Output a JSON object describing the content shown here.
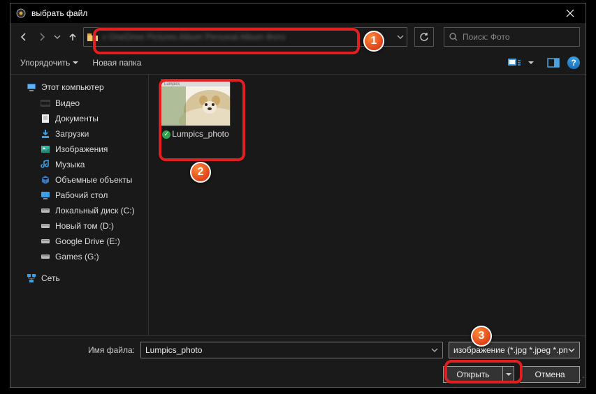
{
  "titlebar": {
    "title": "выбрать файл"
  },
  "nav": {
    "breadcrumb_blurred": "«  OneDrive   Pictures   Album Personal Album   Фото",
    "search_placeholder": "Поиск: Фото"
  },
  "toolbar": {
    "organize": "Упорядочить",
    "new_folder": "Новая папка"
  },
  "sidebar": {
    "this_pc": "Этот компьютер",
    "items": [
      "Видео",
      "Документы",
      "Загрузки",
      "Изображения",
      "Музыка",
      "Объемные объекты",
      "Рабочий стол",
      "Локальный диск (C:)",
      "Новый том (D:)",
      "Google Drive (E:)",
      "Games (G:)"
    ],
    "network": "Сеть"
  },
  "files": {
    "item0": {
      "name": "Lumpics_photo"
    }
  },
  "footer": {
    "label": "Имя файла:",
    "filename": "Lumpics_photo",
    "filetype": "изображение (*.jpg *.jpeg *.pn",
    "open": "Открыть",
    "cancel": "Отмена"
  },
  "annotations": {
    "b1": "1",
    "b2": "2",
    "b3": "3"
  }
}
